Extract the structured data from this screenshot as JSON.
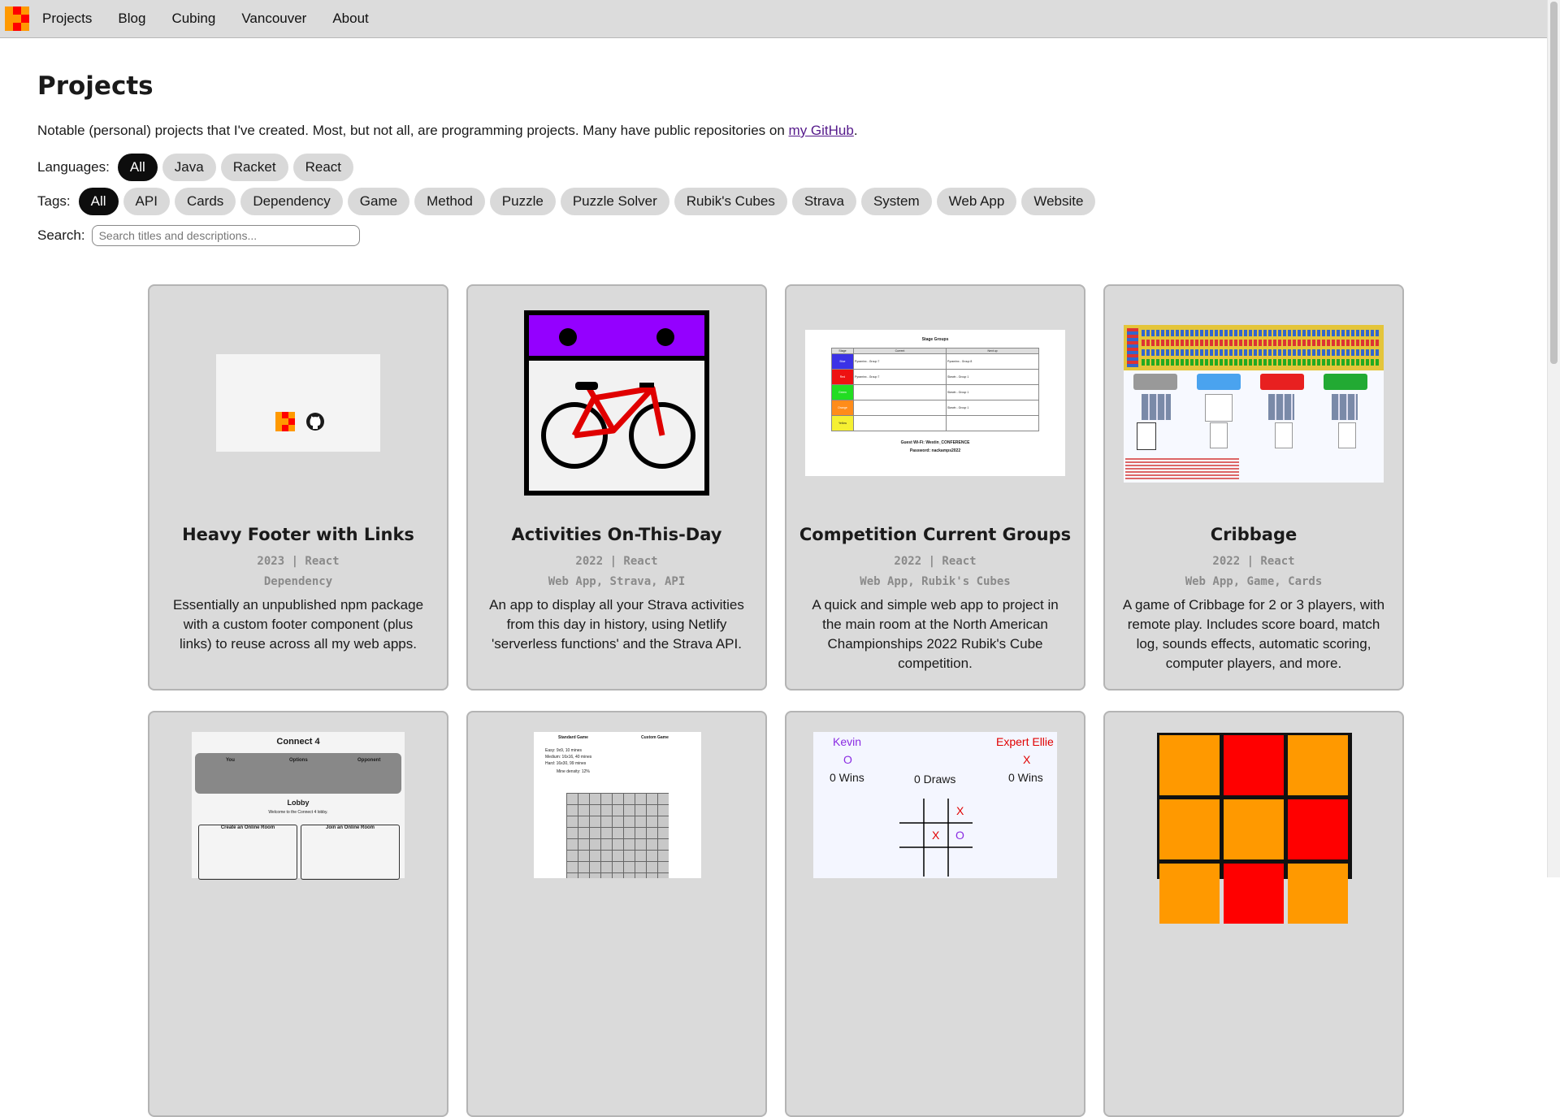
{
  "nav": {
    "items": [
      {
        "label": "Projects"
      },
      {
        "label": "Blog"
      },
      {
        "label": "Cubing"
      },
      {
        "label": "Vancouver"
      },
      {
        "label": "About"
      }
    ]
  },
  "page": {
    "title": "Projects",
    "intro": "Notable (personal) projects that I've created. Most, but not all, are programming projects. Many have public repositories on ",
    "intro_link": "my GitHub",
    "intro_end": "."
  },
  "filters": {
    "languages_label": "Languages:",
    "languages": [
      "All",
      "Java",
      "Racket",
      "React"
    ],
    "languages_selected": "All",
    "tags_label": "Tags:",
    "tags": [
      "All",
      "API",
      "Cards",
      "Dependency",
      "Game",
      "Method",
      "Puzzle",
      "Puzzle Solver",
      "Rubik's Cubes",
      "Strava",
      "System",
      "Web App",
      "Website"
    ],
    "tags_selected": "All",
    "search_label": "Search:",
    "search_placeholder": "Search titles and descriptions..."
  },
  "projects": [
    {
      "title": "Heavy Footer with Links",
      "meta": "2023 | React",
      "tags": "Dependency",
      "description": "Essentially an unpublished npm package with a custom footer component (plus links) to reuse across all my web apps."
    },
    {
      "title": "Activities On-This-Day",
      "meta": "2022 | React",
      "tags": "Web App, Strava, API",
      "description": "An app to display all your Strava activities from this day in history, using Netlify 'serverless functions' and the Strava API."
    },
    {
      "title": "Competition Current Groups",
      "meta": "2022 | React",
      "tags": "Web App, Rubik's Cubes",
      "description": "A quick and simple web app to project in the main room at the North American Championships 2022 Rubik's Cube competition."
    },
    {
      "title": "Cribbage",
      "meta": "2022 | React",
      "tags": "Web App, Game, Cards",
      "description": "A game of Cribbage for 2 or 3 players, with remote play. Includes score board, match log, sounds effects, automatic scoring, computer players, and more."
    }
  ],
  "thumbs": {
    "groups": {
      "title": "Stage Groups",
      "col_stage": "Stage",
      "col_current": "Current",
      "col_next": "Next up",
      "rows": [
        {
          "stage": "Blue",
          "color": "#3b32e6",
          "current": "Pyraminx - Group 7",
          "next": "Pyraminx - Group 8"
        },
        {
          "stage": "Red",
          "color": "#ee1111",
          "current": "Pyraminx - Group 7",
          "next": "Skewb - Group 1"
        },
        {
          "stage": "Green",
          "color": "#22dd22",
          "current": "",
          "next": "Skewb - Group 1"
        },
        {
          "stage": "Orange",
          "color": "#ff8c1a",
          "current": "",
          "next": "Skewb - Group 1"
        },
        {
          "stage": "Yellow",
          "color": "#f5f032",
          "current": "",
          "next": ""
        }
      ],
      "wifi": "Guest Wi-Fi: Westin_CONFERENCE",
      "password": "Password: nackamps2022"
    },
    "connect4": {
      "title": "Connect 4",
      "you": "You",
      "options": "Options",
      "opponent": "Opponent",
      "lobby": "Lobby",
      "welcome": "Welcome to the Connect 4 lobby.",
      "create": "Create an Online Room",
      "join": "Join an Online Room"
    },
    "minesweeper": {
      "standard": "Standard Game",
      "custom": "Custom Game",
      "easy": "Easy: 9x9, 10 mines",
      "medium": "Medium: 16x16, 40 mines",
      "hard": "Hard: 16x30, 99 mines",
      "density": "Mine density: 12%"
    },
    "tictactoe": {
      "p1": "Kevin",
      "p1_mark": "O",
      "p1_wins": "0 Wins",
      "draws": "0 Draws",
      "p2": "Expert Ellie",
      "p2_mark": "X",
      "p2_wins": "0 Wins"
    }
  },
  "colors": {
    "accent": "#0d0d0d",
    "card_bg": "#dadada",
    "strava_purple": "#9400ff",
    "bike_red": "#e00000",
    "cube_orange": "#ff9900",
    "cube_red": "#ff0000"
  }
}
